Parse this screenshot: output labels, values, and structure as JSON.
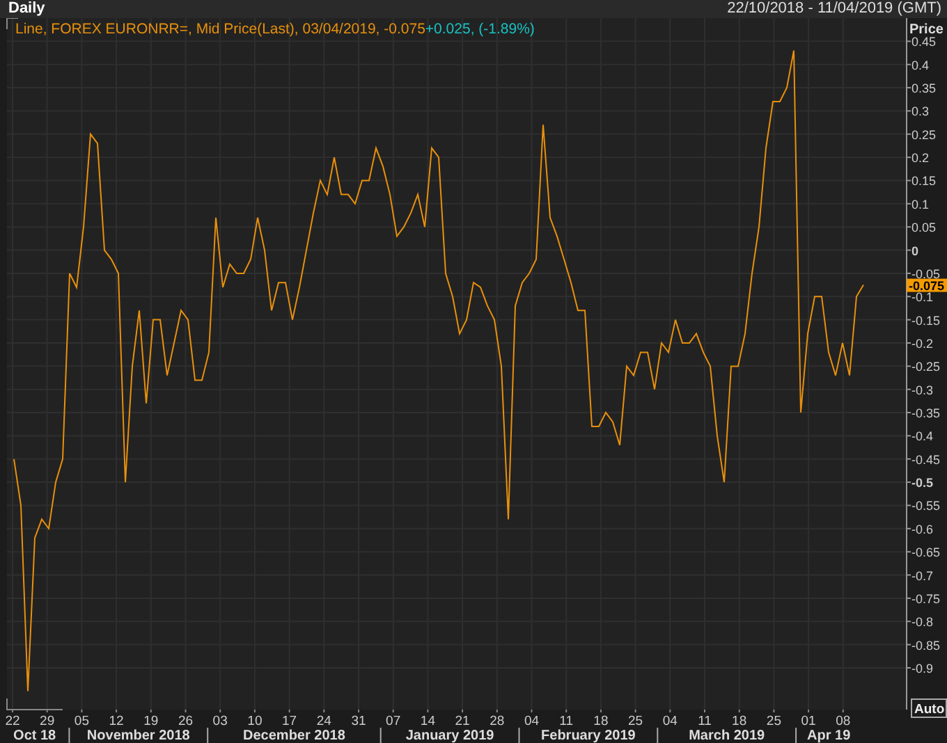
{
  "header": {
    "interval": "Daily",
    "date_range": "22/10/2018 - 11/04/2019 (GMT)"
  },
  "chart": {
    "legend": {
      "series_text": "Line, FOREX EURONRR=, Mid Price(Last), 03/04/2019, -0.075",
      "change_text": "+0.025, (-1.89%)"
    },
    "last_value": "-0.075",
    "auto_button": "Auto",
    "day_labels": [
      "22",
      "29",
      "05",
      "12",
      "19",
      "26",
      "03",
      "10",
      "17",
      "24",
      "31",
      "07",
      "14",
      "21",
      "28",
      "04",
      "11",
      "18",
      "25",
      "04",
      "11",
      "18",
      "25",
      "01",
      "08"
    ],
    "months": [
      "Oct 18",
      "November 2018",
      "December 2018",
      "January 2019",
      "February 2019",
      "March 2019",
      "Apr 19"
    ],
    "chart_data": {
      "type": "line",
      "ylabel": "Price",
      "grid": true,
      "ylim": [
        -0.99,
        0.5
      ],
      "yticks": [
        0.45,
        0.4,
        0.35,
        0.3,
        0.25,
        0.2,
        0.15,
        0.1,
        0.05,
        0,
        -0.05,
        -0.1,
        -0.15,
        -0.2,
        -0.25,
        -0.3,
        -0.35,
        -0.4,
        -0.45,
        -0.5,
        -0.55,
        -0.6,
        -0.65,
        -0.7,
        -0.75,
        -0.8,
        -0.85,
        -0.9
      ],
      "series": [
        {
          "color": "#e8900c",
          "values": [
            -0.45,
            -0.55,
            -0.95,
            -0.62,
            -0.58,
            -0.6,
            -0.5,
            -0.45,
            -0.05,
            -0.08,
            0.05,
            0.25,
            0.23,
            0.0,
            -0.02,
            -0.05,
            -0.5,
            -0.25,
            -0.13,
            -0.33,
            -0.15,
            -0.15,
            -0.27,
            -0.2,
            -0.13,
            -0.15,
            -0.28,
            -0.28,
            -0.22,
            0.07,
            -0.08,
            -0.03,
            -0.05,
            -0.05,
            -0.02,
            0.07,
            0.0,
            -0.13,
            -0.07,
            -0.07,
            -0.15,
            -0.08,
            0.0,
            0.08,
            0.15,
            0.12,
            0.2,
            0.12,
            0.12,
            0.1,
            0.15,
            0.15,
            0.22,
            0.18,
            0.12,
            0.03,
            0.05,
            0.08,
            0.12,
            0.05,
            0.22,
            0.2,
            -0.05,
            -0.1,
            -0.18,
            -0.15,
            -0.07,
            -0.08,
            -0.12,
            -0.15,
            -0.25,
            -0.58,
            -0.12,
            -0.07,
            -0.05,
            -0.02,
            0.27,
            0.07,
            0.03,
            -0.02,
            -0.07,
            -0.13,
            -0.13,
            -0.38,
            -0.38,
            -0.35,
            -0.37,
            -0.42,
            -0.25,
            -0.27,
            -0.22,
            -0.22,
            -0.3,
            -0.2,
            -0.22,
            -0.15,
            -0.2,
            -0.2,
            -0.18,
            -0.22,
            -0.25,
            -0.4,
            -0.5,
            -0.25,
            -0.25,
            -0.18,
            -0.05,
            0.05,
            0.22,
            0.32,
            0.32,
            0.35,
            0.43,
            -0.35,
            -0.18,
            -0.1,
            -0.1,
            -0.22,
            -0.27,
            -0.2,
            -0.27,
            -0.1,
            -0.075
          ]
        }
      ]
    }
  }
}
